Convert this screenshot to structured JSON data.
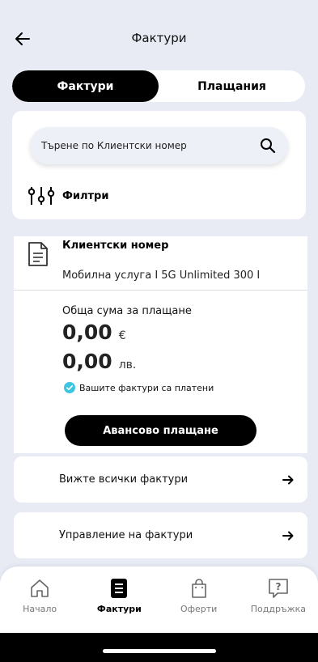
{
  "header": {
    "title": "Фактури"
  },
  "tabs": [
    {
      "label": "Фактури"
    },
    {
      "label": "Плащания"
    }
  ],
  "search": {
    "placeholder": "Търене по Клиентски номер",
    "value": ""
  },
  "filters": {
    "label": "Филтри"
  },
  "account": {
    "title": "Клиентски номер",
    "service": "Мобилна услуга I 5G Unlimited 300 I",
    "total_label": "Обща сума за плащане",
    "amount_eur": "0,00",
    "currency_eur": "€",
    "amount_bgn": "0,00",
    "currency_bgn": "лв.",
    "paid_status": "Вашите фактури са платени",
    "advance_button": "Авансово плащане"
  },
  "links": [
    {
      "label": "Вижте всички фактури"
    },
    {
      "label": "Управление на фактури"
    }
  ],
  "bottom_nav": [
    {
      "label": "Начало",
      "icon": "home-icon"
    },
    {
      "label": "Фактури",
      "icon": "invoice-icon"
    },
    {
      "label": "Оферти",
      "icon": "shopping-bag-icon"
    },
    {
      "label": "Поддръжка",
      "icon": "help-icon"
    }
  ],
  "colors": {
    "accent": "#000000",
    "background": "#e8ebf4",
    "paid_check": "#3ec6e0"
  }
}
